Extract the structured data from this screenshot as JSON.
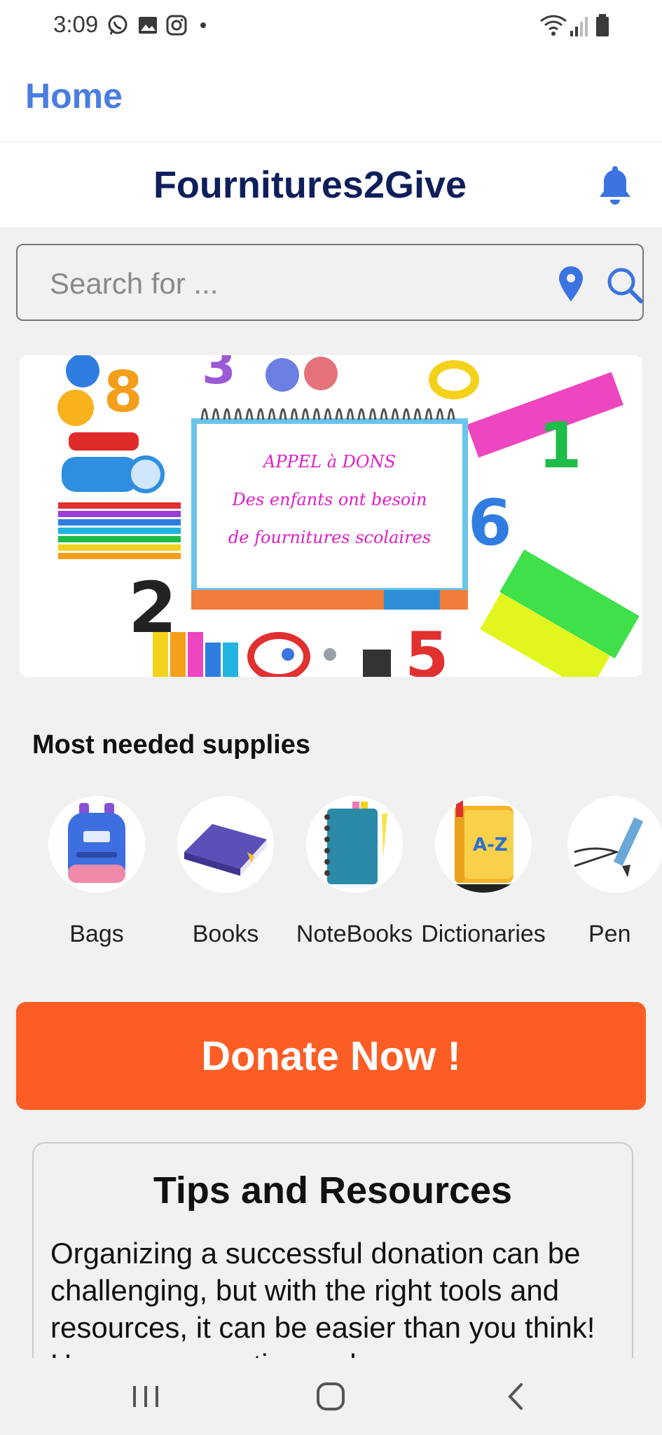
{
  "status_bar": {
    "time": "3:09",
    "left_icons": [
      "whatsapp-icon",
      "image-icon",
      "instagram-icon",
      "dot-icon"
    ],
    "right_icons": [
      "wifi-icon",
      "signal-icon",
      "battery-icon"
    ]
  },
  "header": {
    "home_label": "Home",
    "app_title": "Fournitures2Give",
    "notification_icon": "bell-icon"
  },
  "search": {
    "placeholder": "Search for ...",
    "location_icon": "location-pin-icon",
    "search_icon": "search-icon"
  },
  "banner": {
    "line1": "APPEL à DONS",
    "line2": "Des enfants ont besoin",
    "line3": "de fournitures scolaires",
    "slides": 2,
    "active_slide": 1
  },
  "supplies": {
    "title": "Most needed supplies",
    "items": [
      {
        "label": "Bags",
        "icon": "backpack-icon"
      },
      {
        "label": "Books",
        "icon": "book-icon"
      },
      {
        "label": "NoteBooks",
        "icon": "notebook-icon"
      },
      {
        "label": "Dictionaries",
        "icon": "dictionary-icon"
      },
      {
        "label": "Pen",
        "icon": "pen-icon"
      }
    ]
  },
  "donate": {
    "label": "Donate Now !"
  },
  "tips": {
    "title": "Tips and Resources",
    "body": "Organizing a successful donation can be challenging, but with the right tools and resources, it can be easier than you think! Here are some tips and"
  },
  "colors": {
    "accent_blue": "#4a7de0",
    "title_navy": "#0f1f5c",
    "donate_orange": "#fc5d25",
    "background": "#f1f1f1"
  }
}
